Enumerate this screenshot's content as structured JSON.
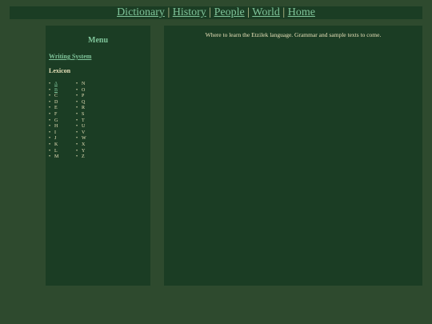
{
  "nav": {
    "items": [
      {
        "label": "Dictionary"
      },
      {
        "label": "History"
      },
      {
        "label": "People"
      },
      {
        "label": "World"
      },
      {
        "label": "Home"
      }
    ],
    "separator": "|"
  },
  "sidebar": {
    "title": "Menu",
    "writing_system_link": "Writing System",
    "lexicon_heading": "Lexicon",
    "bullet": "•",
    "letters_col1": [
      {
        "letter": "Δ",
        "linked": true
      },
      {
        "letter": "B",
        "linked": true
      },
      {
        "letter": "C",
        "linked": false
      },
      {
        "letter": "D",
        "linked": false
      },
      {
        "letter": "E",
        "linked": false
      },
      {
        "letter": "F",
        "linked": false
      },
      {
        "letter": "G",
        "linked": false
      },
      {
        "letter": "H",
        "linked": false
      },
      {
        "letter": "I",
        "linked": false
      },
      {
        "letter": "J",
        "linked": false
      },
      {
        "letter": "K",
        "linked": false
      },
      {
        "letter": "L",
        "linked": false
      },
      {
        "letter": "M",
        "linked": false
      }
    ],
    "letters_col2": [
      {
        "letter": "N",
        "linked": false
      },
      {
        "letter": "O",
        "linked": false
      },
      {
        "letter": "P",
        "linked": false
      },
      {
        "letter": "Q",
        "linked": false
      },
      {
        "letter": "R",
        "linked": false
      },
      {
        "letter": "S",
        "linked": false
      },
      {
        "letter": "T",
        "linked": false
      },
      {
        "letter": "U",
        "linked": false
      },
      {
        "letter": "V",
        "linked": false
      },
      {
        "letter": "W",
        "linked": false
      },
      {
        "letter": "X",
        "linked": false
      },
      {
        "letter": "Y",
        "linked": false
      },
      {
        "letter": "Z",
        "linked": false
      }
    ]
  },
  "main": {
    "intro_text": "Where to learn the Etzilek language. Grammar and sample texts to come."
  },
  "colors": {
    "page_background": "#2e4a2e",
    "panel_background": "#1b3d24",
    "link": "#7fc49a",
    "text": "#e6e0b8"
  }
}
